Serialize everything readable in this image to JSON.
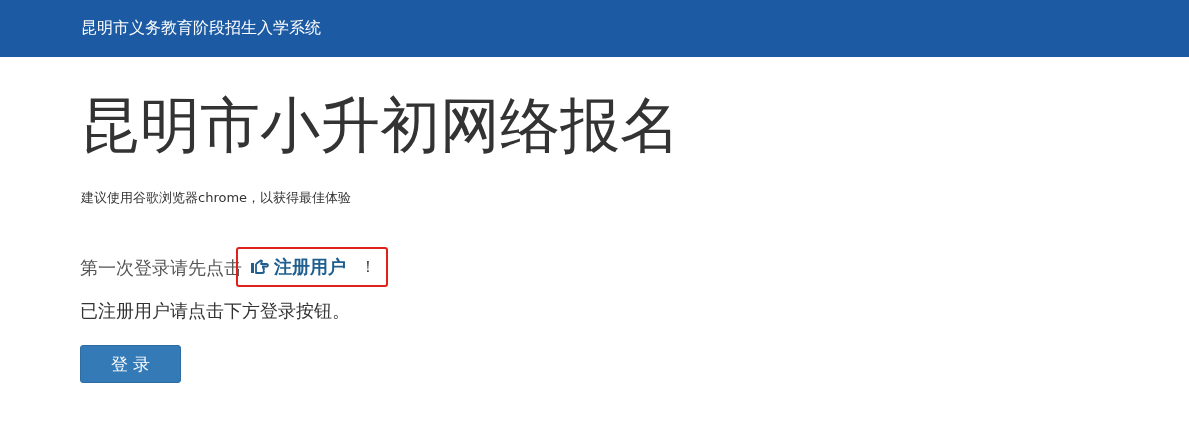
{
  "navbar": {
    "brand": "昆明市义务教育阶段招生入学系统"
  },
  "heading": "昆明市小升初网络报名",
  "hint": "建议使用谷歌浏览器chrome，以获得最佳体验",
  "first_login": {
    "text": "第一次登录请先点击",
    "link": "注册用户",
    "suffix": "！",
    "highlighted": true
  },
  "registered_text": "已注册用户请点击下方登录按钮。",
  "login_button": "登 录"
}
